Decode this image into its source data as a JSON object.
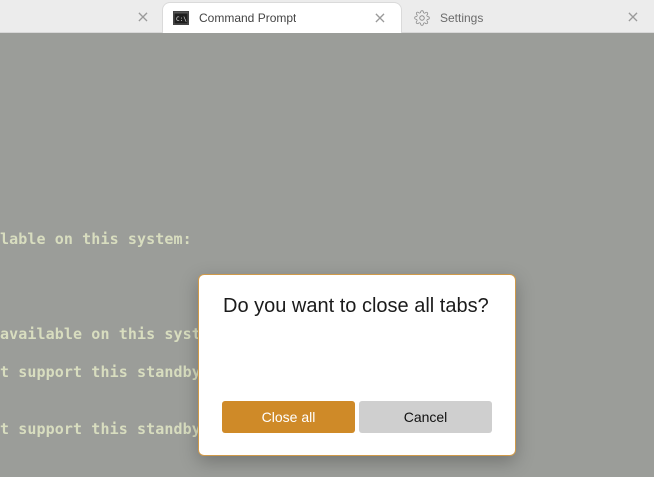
{
  "tabs": {
    "left_close": "×",
    "command_prompt": {
      "title": "Command Prompt",
      "close": "×",
      "icon": "cmd-icon"
    },
    "settings": {
      "title": "Settings",
      "close": "×",
      "icon": "gear-icon"
    }
  },
  "terminal": {
    "lines": [
      "lable on this system:",
      "available on this syste",
      "t support this standby",
      "t support this standby"
    ]
  },
  "dialog": {
    "title": "Do you want to close all tabs?",
    "primary_label": "Close all",
    "secondary_label": "Cancel"
  },
  "colors": {
    "dim_background": "#9b9d99",
    "terminal_text": "#d8ddbf",
    "accent": "#cf8a28",
    "dialog_border": "#d09a4a"
  }
}
